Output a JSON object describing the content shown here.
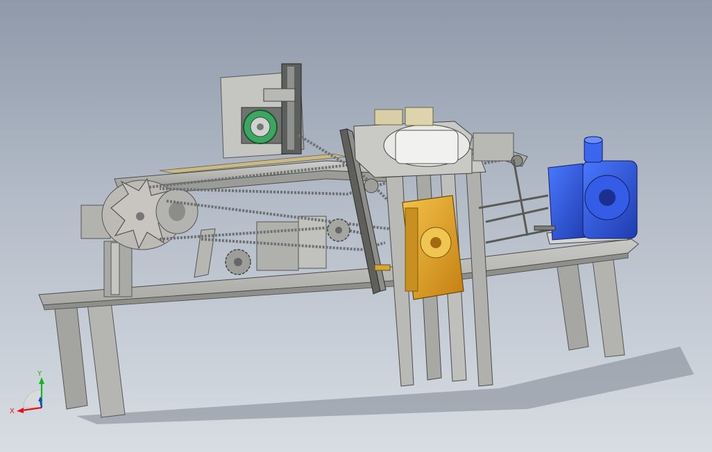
{
  "viewport": {
    "background_top": "#8f99a9",
    "background_bottom": "#d8dde3"
  },
  "colors": {
    "frame_gray": "#b9bab6",
    "frame_dark": "#6e706c",
    "chain": "#7a7d80",
    "motor_blue": "#2b4fd0",
    "gearbox_gold": "#e0a427",
    "pulley_green": "#3aa860",
    "axis_x": "#e3141a",
    "axis_y": "#14b41e",
    "axis_z": "#1e3cdc"
  },
  "triad": {
    "x_label": "X",
    "y_label": "Y",
    "icons": [
      "x-axis-arrow-icon",
      "y-axis-arrow-icon",
      "z-axis-arrow-icon"
    ]
  }
}
